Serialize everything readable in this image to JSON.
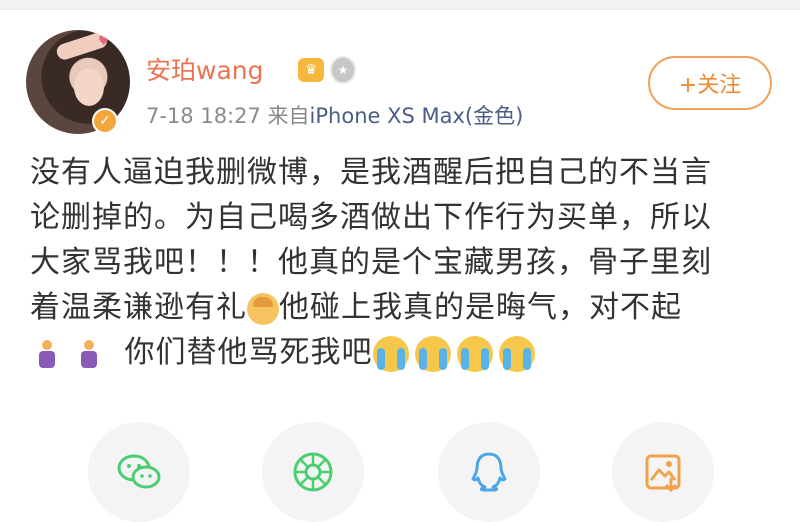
{
  "post": {
    "username": "安珀wang",
    "timestamp": "7-18 18:27",
    "source_prefix": "来自",
    "source": "iPhone XS Max(金色)",
    "follow_label": "+关注",
    "content_lines": [
      "没有人逼迫我删微博，是我酒醒后把自己的不当言",
      "论删掉的。为自己喝多酒做出下作行为买单，所以",
      "大家骂我吧！！！他真的是个宝藏男孩，骨子里刻"
    ],
    "line4_a": "着温柔谦逊有礼",
    "line4_b": "他碰上我真的是晦气，对不起",
    "line5": "你们替他骂死我吧"
  },
  "icons": {
    "verified": "verified-badge-icon",
    "crown": "crown-badge-icon",
    "medal": "medal-badge-icon",
    "share": [
      "wechat-icon",
      "moments-icon",
      "qq-icon",
      "save-image-icon"
    ]
  },
  "colors": {
    "username": "#eb7350",
    "follow_border": "#f0a356",
    "source_link": "#4a5d86",
    "wechat": "#4ccd72",
    "qq": "#4aa6e8",
    "save": "#f0a24a"
  }
}
